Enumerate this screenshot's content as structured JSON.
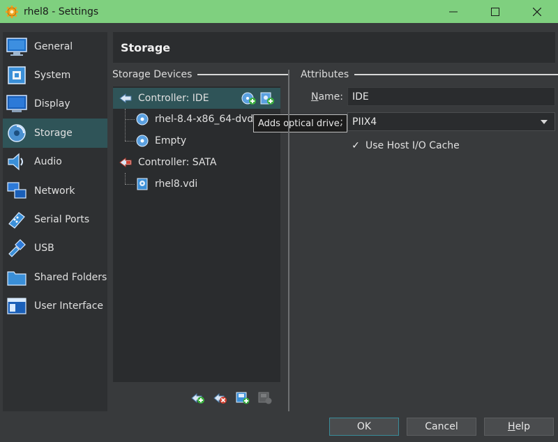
{
  "window": {
    "title": "rhel8 - Settings",
    "controls": {
      "minimize": "—",
      "maximize": "☐",
      "close": "✕"
    }
  },
  "sidebar": {
    "items": [
      {
        "label": "General",
        "icon": "general-icon",
        "active": false
      },
      {
        "label": "System",
        "icon": "system-icon",
        "active": false
      },
      {
        "label": "Display",
        "icon": "display-icon",
        "active": false
      },
      {
        "label": "Storage",
        "icon": "storage-icon",
        "active": true
      },
      {
        "label": "Audio",
        "icon": "audio-icon",
        "active": false
      },
      {
        "label": "Network",
        "icon": "network-icon",
        "active": false
      },
      {
        "label": "Serial Ports",
        "icon": "serial-ports-icon",
        "active": false
      },
      {
        "label": "USB",
        "icon": "usb-icon",
        "active": false
      },
      {
        "label": "Shared Folders",
        "icon": "shared-folders-icon",
        "active": false
      },
      {
        "label": "User Interface",
        "icon": "user-interface-icon",
        "active": false
      }
    ]
  },
  "header": {
    "title": "Storage"
  },
  "storage_devices": {
    "label": "Storage Devices",
    "tree": [
      {
        "label": "Controller: IDE",
        "type": "controller",
        "selected": true
      },
      {
        "label": "rhel-8.4-x86_64-dvd_",
        "type": "optical"
      },
      {
        "label": "Empty",
        "type": "optical"
      },
      {
        "label": "Controller: SATA",
        "type": "controller"
      },
      {
        "label": "rhel8.vdi",
        "type": "hard-disk"
      }
    ],
    "tooltip": "Adds optical drive."
  },
  "attributes": {
    "label": "Attributes",
    "name_label_first": "N",
    "name_label_rest": "ame:",
    "name_value": "IDE",
    "type_label": ":",
    "type_value": "PIIX4",
    "host_io_cache": {
      "label": "Use Host I/O Cache",
      "checked": true,
      "mark": "✓"
    }
  },
  "buttons": {
    "ok": "OK",
    "cancel": "Cancel",
    "help_first": "H",
    "help_rest": "elp"
  },
  "colors": {
    "titlebar": "#7fd07f",
    "selection": "#2f5458",
    "background": "#383a3c"
  }
}
